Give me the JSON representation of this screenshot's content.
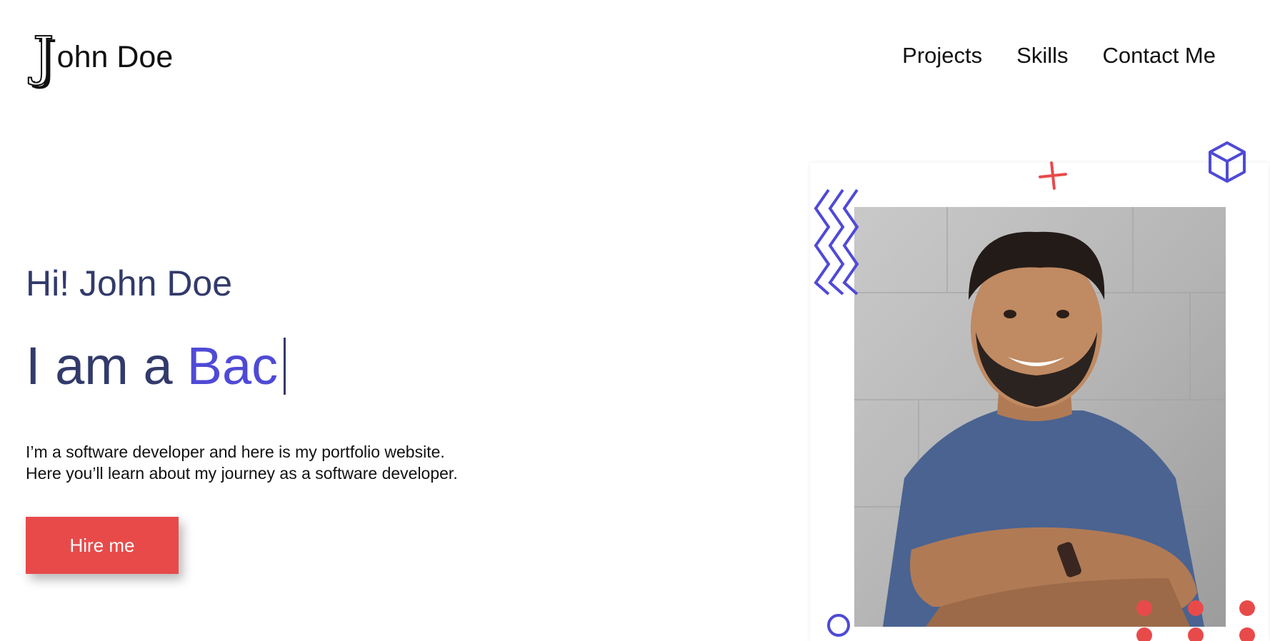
{
  "header": {
    "logo_mark": "J",
    "logo_text": "ohn Doe",
    "nav": [
      "Projects",
      "Skills",
      "Contact Me"
    ]
  },
  "hero": {
    "greeting": "Hi! John Doe",
    "role_prefix": "I am a",
    "role_typed": "Bac",
    "description": [
      "I’m a software developer and here is my portfolio website.",
      "Here you’ll learn about my journey as a software developer."
    ],
    "cta_label": "Hire me"
  },
  "colors": {
    "accent": "#4f4ad6",
    "heading": "#323a6b",
    "button": "#e84a4a",
    "dots": "#e84a4a"
  },
  "icons": [
    "cube-icon",
    "plus-icon",
    "zigzag-icon",
    "ring-icon",
    "dot-grid-icon"
  ]
}
